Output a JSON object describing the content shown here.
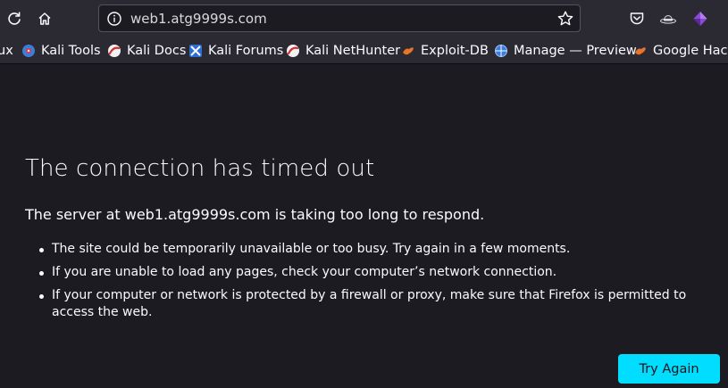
{
  "browser": {
    "url": "web1.atg9999s.com",
    "accent": "#00ddff"
  },
  "bookmarks": [
    {
      "label": "ux"
    },
    {
      "label": "Kali Tools"
    },
    {
      "label": "Kali Docs"
    },
    {
      "label": "Kali Forums"
    },
    {
      "label": "Kali NetHunter"
    },
    {
      "label": "Exploit-DB"
    },
    {
      "label": "Manage — Preview"
    },
    {
      "label": "Google Hacki"
    }
  ],
  "error": {
    "title": "The connection has timed out",
    "lead": "The server at web1.atg9999s.com is taking too long to respond.",
    "bullets": [
      "The site could be temporarily unavailable or too busy. Try again in a few moments.",
      "If you are unable to load any pages, check your computer’s network connection.",
      "If your computer or network is protected by a firewall or proxy, make sure that Firefox is permitted to access the web."
    ],
    "button": "Try Again"
  }
}
